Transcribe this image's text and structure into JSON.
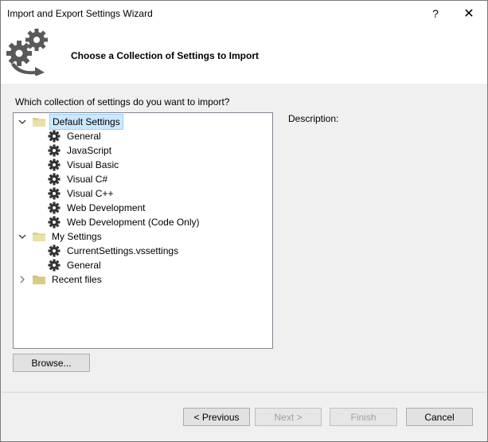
{
  "window": {
    "title": "Import and Export Settings Wizard",
    "help_label": "?",
    "close_label": "✕"
  },
  "header": {
    "title": "Choose a Collection of Settings to Import"
  },
  "main": {
    "question": "Which collection of settings do you want to import?",
    "description_label": "Description:",
    "tree": {
      "default": {
        "label": "Default Settings",
        "expanded": true,
        "selected": true
      },
      "default_items": [
        "General",
        "JavaScript",
        "Visual Basic",
        "Visual C#",
        "Visual C++",
        "Web Development",
        "Web Development (Code Only)"
      ],
      "my": {
        "label": "My Settings",
        "expanded": true
      },
      "my_items": [
        "CurrentSettings.vssettings",
        "General"
      ],
      "recent": {
        "label": "Recent files",
        "expanded": false
      }
    },
    "browse_label": "Browse..."
  },
  "footer": {
    "previous_label": "< Previous",
    "next_label": "Next >",
    "finish_label": "Finish",
    "cancel_label": "Cancel"
  },
  "colors": {
    "selection": "#cce8ff",
    "folder": "#dcd18a"
  },
  "icons": {
    "wizard": "settings-gears-arrow-icon",
    "folder": "folder-icon",
    "item": "gear-icon"
  }
}
